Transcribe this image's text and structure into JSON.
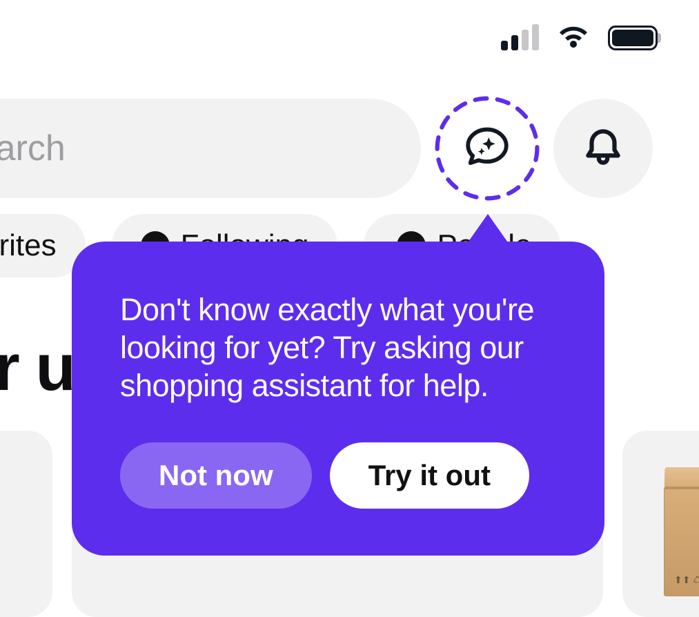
{
  "search": {
    "placeholder": "Search"
  },
  "chips": {
    "favorites_label_fragment": "vorites",
    "following_label": "Following",
    "people_label_fragment": "People"
  },
  "heading": {
    "fragment": "er u"
  },
  "popover": {
    "text": "Don't know exactly what you're looking for yet? Try asking our shopping assistant for help.",
    "dismiss_label": "Not now",
    "confirm_label": "Try it out",
    "accent_color": "#5d2dee"
  },
  "icons": {
    "chat": "chat-sparkle-icon",
    "bell": "bell-icon",
    "wifi": "wifi-icon",
    "signal": "cellular-signal-icon",
    "battery": "battery-icon",
    "post_badge": "postal-horn-icon"
  }
}
